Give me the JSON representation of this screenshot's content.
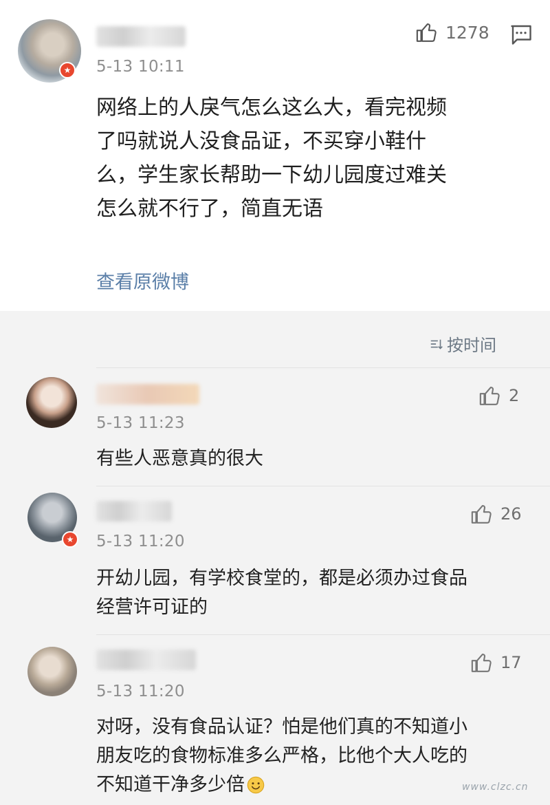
{
  "post": {
    "time": "5-13 10:11",
    "likes": "1278",
    "text_lines": [
      "网络上的人戾气怎么这么大，看完视频",
      "了吗就说人没食品证，不买穿小鞋什",
      "么，学生家长帮助一下幼儿园度过难关",
      "怎么就不行了，简直无语"
    ],
    "view_original": "查看原微博"
  },
  "sort": {
    "label": "按时间"
  },
  "comments": [
    {
      "time": "5-13 11:23",
      "likes": "2",
      "lines": [
        "有些人恶意真的很大"
      ]
    },
    {
      "time": "5-13 11:20",
      "likes": "26",
      "lines": [
        "开幼儿园，有学校食堂的，都是必须办过食品",
        "经营许可证的"
      ]
    },
    {
      "time": "5-13 11:20",
      "likes": "17",
      "lines": [
        "对呀，没有食品认证？怕是他们真的不知道小",
        "朋友吃的食物标准多么严格，比他个大人吃的",
        "不知道干净多少倍"
      ]
    }
  ],
  "watermark": {
    "text": "www.clzc.cn"
  },
  "colors": {
    "badge": "#e8472f",
    "link": "#5b7fa8",
    "meta": "#8e8e8e"
  },
  "icons": {
    "like": "thumbs-up-icon",
    "comment": "comment-icon",
    "sort": "sort-icon",
    "emoji": "smile-emoji-icon"
  }
}
